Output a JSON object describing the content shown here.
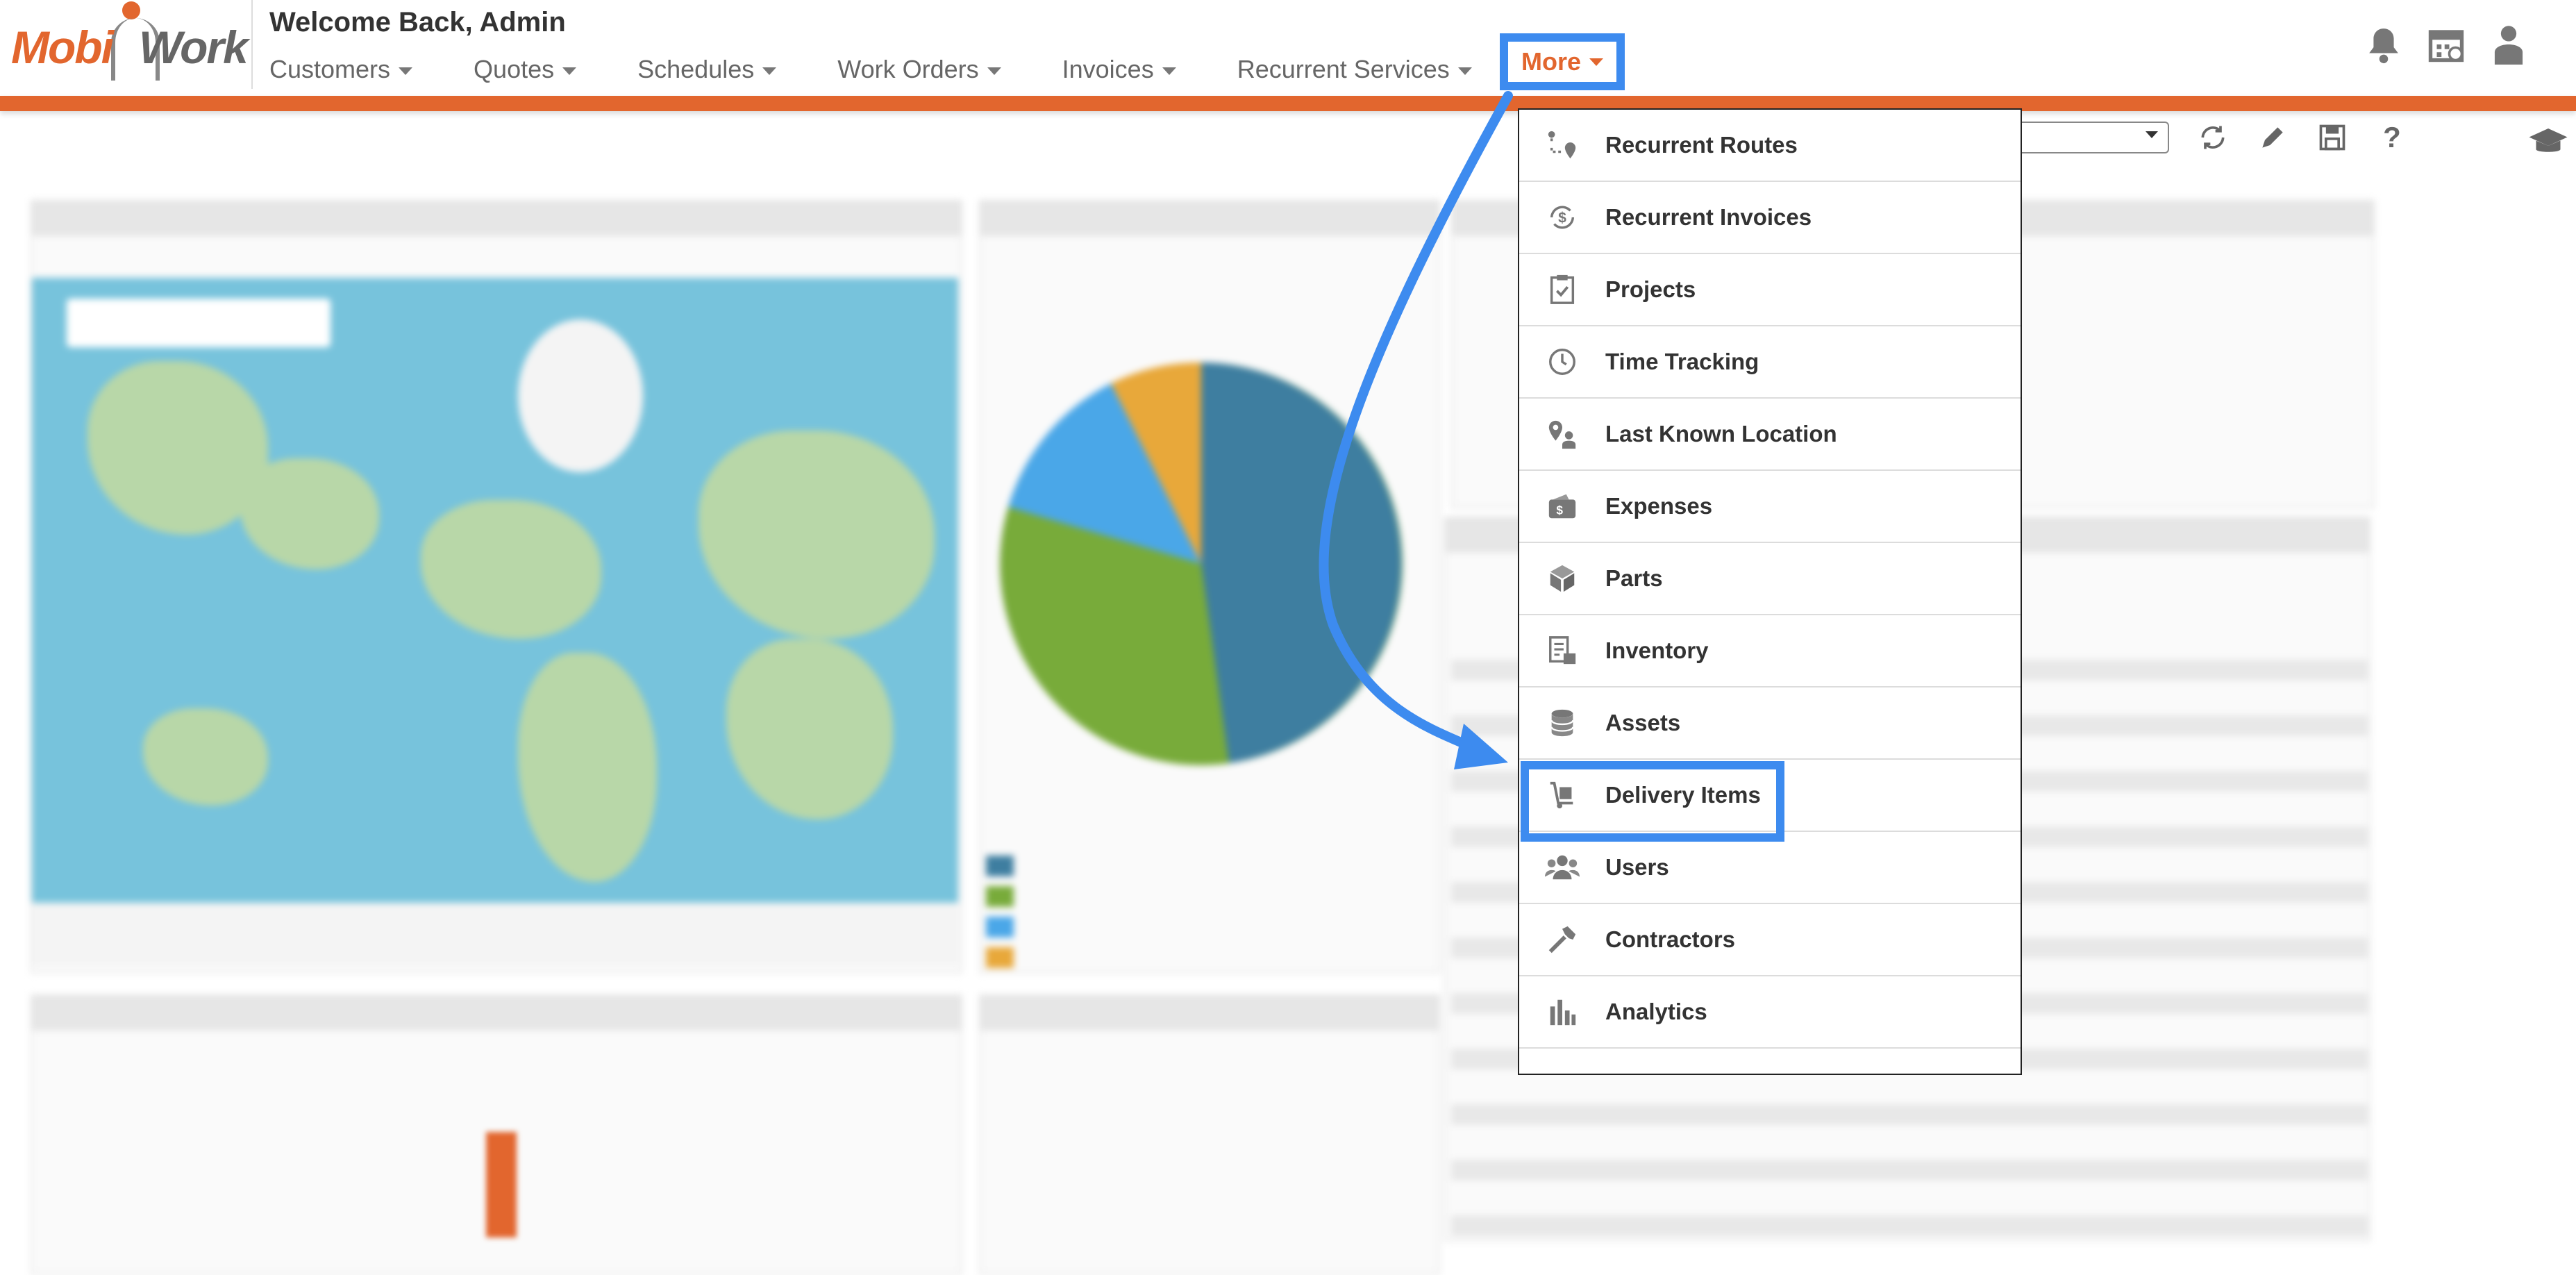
{
  "header": {
    "logo_part1": "Mobi",
    "logo_part2": "Work",
    "welcome": "Welcome Back,  Admin"
  },
  "nav": {
    "items": [
      {
        "label": "Customers"
      },
      {
        "label": "Quotes"
      },
      {
        "label": "Schedules"
      },
      {
        "label": "Work Orders"
      },
      {
        "label": "Invoices"
      },
      {
        "label": "Recurrent Services"
      }
    ],
    "more_label": "More"
  },
  "top_icons": [
    "bell-icon",
    "calendar-icon",
    "user-icon"
  ],
  "toolbar_icons": [
    "refresh-icon",
    "pencil-icon",
    "save-icon",
    "help-icon"
  ],
  "menu": {
    "items": [
      {
        "label": "Recurrent Routes",
        "icon": "route-icon"
      },
      {
        "label": "Recurrent Invoices",
        "icon": "recurrent-invoice-icon"
      },
      {
        "label": "Projects",
        "icon": "clipboard-icon"
      },
      {
        "label": "Time Tracking",
        "icon": "clock-icon"
      },
      {
        "label": "Last Known Location",
        "icon": "location-person-icon"
      },
      {
        "label": "Expenses",
        "icon": "wallet-icon"
      },
      {
        "label": "Parts",
        "icon": "box-icon"
      },
      {
        "label": "Inventory",
        "icon": "inventory-icon"
      },
      {
        "label": "Assets",
        "icon": "database-icon"
      },
      {
        "label": "Delivery Items",
        "icon": "hand-truck-icon"
      },
      {
        "label": "Users",
        "icon": "users-icon"
      },
      {
        "label": "Contractors",
        "icon": "hammer-icon"
      },
      {
        "label": "Analytics",
        "icon": "bar-chart-icon"
      }
    ],
    "highlighted": "Delivery Items"
  },
  "colors": {
    "brand": "#e2662e",
    "highlight": "#3d8bef",
    "pie": [
      "#3e7ea0",
      "#78ab3a",
      "#4aa7e8",
      "#e8a83a"
    ]
  }
}
